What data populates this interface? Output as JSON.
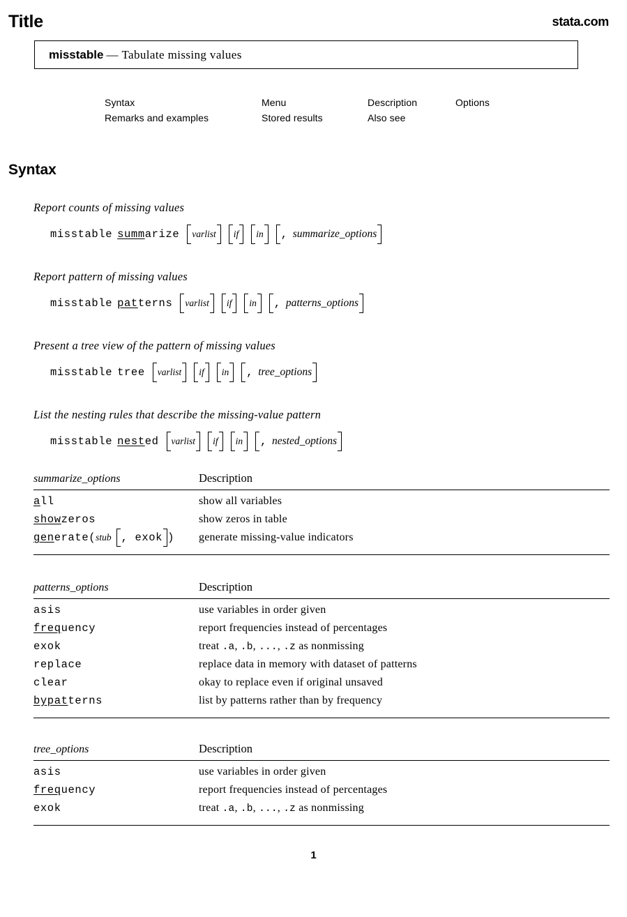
{
  "header": {
    "title": "Title",
    "brand": "stata.com"
  },
  "title_box": {
    "command": "misstable",
    "dash": "—",
    "description": "Tabulate missing values"
  },
  "nav": {
    "row1": [
      "Syntax",
      "Menu",
      "Description",
      "Options"
    ],
    "row2": [
      "Remarks and examples",
      "Stored results",
      "Also see"
    ]
  },
  "sections": {
    "syntax_heading": "Syntax"
  },
  "syntax": [
    {
      "caption": "Report counts of missing values",
      "command": "misstable",
      "sub_underlined": "summ",
      "sub_rest": "arize",
      "args": [
        "varlist",
        "if",
        "in"
      ],
      "options": "summarize_options",
      "comma": ","
    },
    {
      "caption": "Report pattern of missing values",
      "command": "misstable",
      "sub_underlined": "pat",
      "sub_rest": "terns",
      "args": [
        "varlist",
        "if",
        "in"
      ],
      "options": "patterns_options",
      "comma": ","
    },
    {
      "caption": "Present a tree view of the pattern of missing values",
      "command": "misstable",
      "sub_underlined": "",
      "sub_rest": "tree",
      "args": [
        "varlist",
        "if",
        "in"
      ],
      "options": "tree_options",
      "comma": ","
    },
    {
      "caption": "List the nesting rules that describe the missing-value pattern",
      "command": "misstable",
      "sub_underlined": "nest",
      "sub_rest": "ed",
      "args": [
        "varlist",
        "if",
        "in"
      ],
      "options": "nested_options",
      "comma": ","
    }
  ],
  "tables": [
    {
      "name": "summarize_options",
      "desc_header": "Description",
      "rows": [
        {
          "opt_underlined": "a",
          "opt_rest": "ll",
          "desc": "show all variables"
        },
        {
          "opt_underlined": "show",
          "opt_rest": "zeros",
          "desc": "show zeros in table"
        },
        {
          "opt_underlined": "gen",
          "opt_rest": "erate(",
          "arg_italic": "stub",
          "bracket_text": ", exok",
          "close": ")",
          "desc": "generate missing-value indicators"
        }
      ]
    },
    {
      "name": "patterns_options",
      "desc_header": "Description",
      "rows": [
        {
          "opt_underlined": "",
          "opt_rest": "asis",
          "desc": "use variables in order given"
        },
        {
          "opt_underlined": "freq",
          "opt_rest": "uency",
          "desc": "report frequencies instead of percentages"
        },
        {
          "opt_underlined": "",
          "opt_rest": "exok",
          "desc": "treat .a, .b, ..., .z as nonmissing",
          "desc_code": true
        },
        {
          "opt_underlined": "",
          "opt_rest": "replace",
          "desc": "replace data in memory with dataset of patterns"
        },
        {
          "opt_underlined": "",
          "opt_rest": "clear",
          "desc": "okay to replace even if original unsaved"
        },
        {
          "opt_underlined": "bypat",
          "opt_rest": "terns",
          "desc": "list by patterns rather than by frequency"
        }
      ]
    },
    {
      "name": "tree_options",
      "desc_header": "Description",
      "rows": [
        {
          "opt_underlined": "",
          "opt_rest": "asis",
          "desc": "use variables in order given"
        },
        {
          "opt_underlined": "freq",
          "opt_rest": "uency",
          "desc": "report frequencies instead of percentages"
        },
        {
          "opt_underlined": "",
          "opt_rest": "exok",
          "desc": "treat .a, .b, ..., .z as nonmissing",
          "desc_code": true
        }
      ]
    }
  ],
  "footer": {
    "page_number": "1"
  }
}
